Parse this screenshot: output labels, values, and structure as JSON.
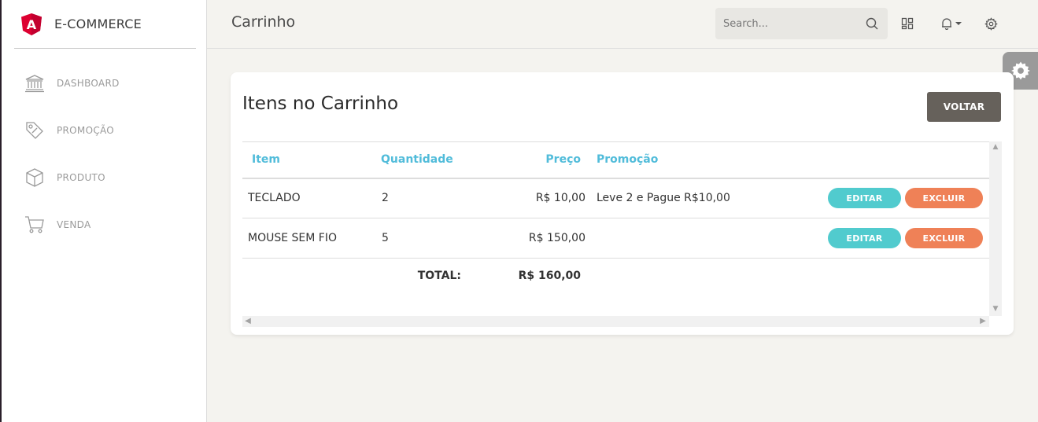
{
  "brand": {
    "name": "E-COMMERCE",
    "logo_icon": "angular-logo-icon",
    "logo_letter": "A"
  },
  "sidebar": {
    "items": [
      {
        "label": "DASHBOARD",
        "icon": "bank-icon"
      },
      {
        "label": "PROMOÇÃO",
        "icon": "tag-icon"
      },
      {
        "label": "PRODUTO",
        "icon": "box-icon"
      },
      {
        "label": "VENDA",
        "icon": "cart-icon"
      }
    ]
  },
  "topbar": {
    "title": "Carrinho",
    "search": {
      "placeholder": "Search...",
      "value": ""
    },
    "icons": [
      "search-icon",
      "grid-icon",
      "bell-icon",
      "gear-icon"
    ]
  },
  "card": {
    "title": "Itens no Carrinho",
    "back_label": "VOLTAR",
    "table": {
      "headers": {
        "item": "Item",
        "quantity": "Quantidade",
        "price": "Preço",
        "promo": "Promoção"
      },
      "rows": [
        {
          "item": "TECLADO",
          "quantity": "2",
          "price": "R$ 10,00",
          "promo": "Leve 2 e Pague R$10,00",
          "edit_label": "EDITAR",
          "delete_label": "EXCLUIR"
        },
        {
          "item": "MOUSE SEM FIO",
          "quantity": "5",
          "price": "R$ 150,00",
          "promo": "",
          "edit_label": "EDITAR",
          "delete_label": "EXCLUIR"
        }
      ],
      "total_label": "TOTAL:",
      "total_value": "R$ 160,00"
    }
  },
  "colors": {
    "accent_info": "#51bcda",
    "edit_button": "#51cbce",
    "delete_button": "#ef8157",
    "back_button": "#66615b",
    "angular_red": "#dd0031"
  }
}
